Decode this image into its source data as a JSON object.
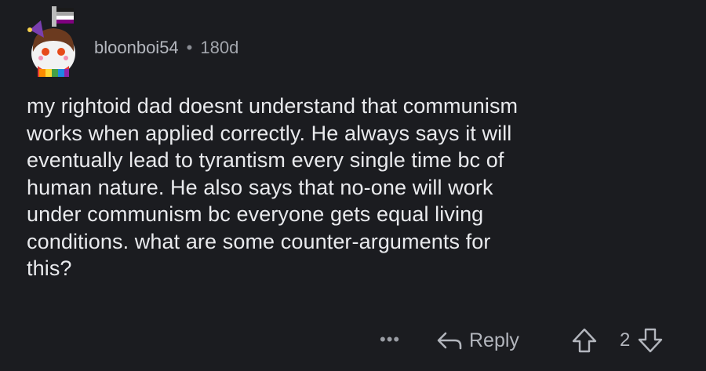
{
  "comment": {
    "username": "bloonboi54",
    "separator": "•",
    "age": "180d",
    "avatar_icon": "user-avatar-snoo-icon",
    "body": "my rightoid dad doesnt understand that communism\nworks when applied correctly. He always says it will\neventually lead to tyrantism every single time bc of\nhuman nature. He also says that no-one will work\nunder communism bc everyone gets equal living\nconditions. what are some counter-arguments for\nthis?"
  },
  "actions": {
    "more_label": "•••",
    "reply_label": "Reply",
    "vote_count": "2",
    "reply_icon": "reply-arrow-icon",
    "upvote_icon": "upvote-arrow-icon",
    "downvote_icon": "downvote-arrow-icon"
  },
  "colors": {
    "background": "#1b1c20",
    "text": "#e9eaed",
    "muted": "#a9acb3",
    "flag_stripes": [
      "#1a1a1a",
      "#a4a4a4",
      "#ffffff",
      "#800080"
    ]
  }
}
